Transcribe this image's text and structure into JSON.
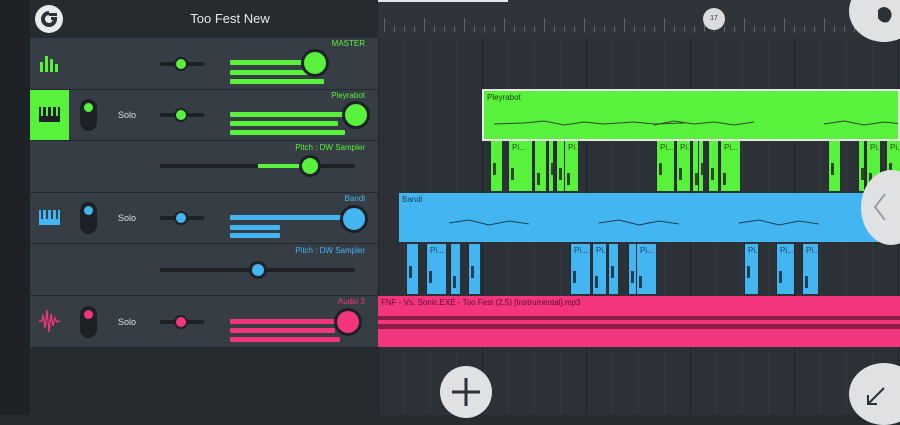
{
  "app": {
    "title": "Too Fest New"
  },
  "ruler": {
    "marker": "17"
  },
  "colors": {
    "green": "#58f23c",
    "blue": "#43b6f2",
    "pink": "#f2357d",
    "panel": "#363d45",
    "dark": "#262b30"
  },
  "tracks": {
    "master": {
      "name": "MASTER",
      "icon": "equalizer-icon"
    },
    "pleyrabot": {
      "name": "Pleyrabot",
      "solo": "Solo",
      "pitch": "Pitch : DW Sampler",
      "icon": "piano-keys-icon",
      "clip": "Pleyrabot"
    },
    "bandi": {
      "name": "Bandi",
      "solo": "Solo",
      "pitch": "Pitch : DW Sampler",
      "icon": "piano-keys-icon",
      "clip": "Bandi"
    },
    "audio3": {
      "name": "Audio 3",
      "solo": "Solo",
      "icon": "waveform-icon",
      "clip": "FNF - Vs. Sonic.EXE - Too Fest (2.5) [Instrumental].mp3"
    }
  },
  "pitch_clips": {
    "label": "Pi..."
  },
  "buttons": {
    "add": "add-icon",
    "collapse": "chevron-left-icon",
    "expand": "expand-arrow-icon",
    "fl": "fruit-logo-icon"
  }
}
